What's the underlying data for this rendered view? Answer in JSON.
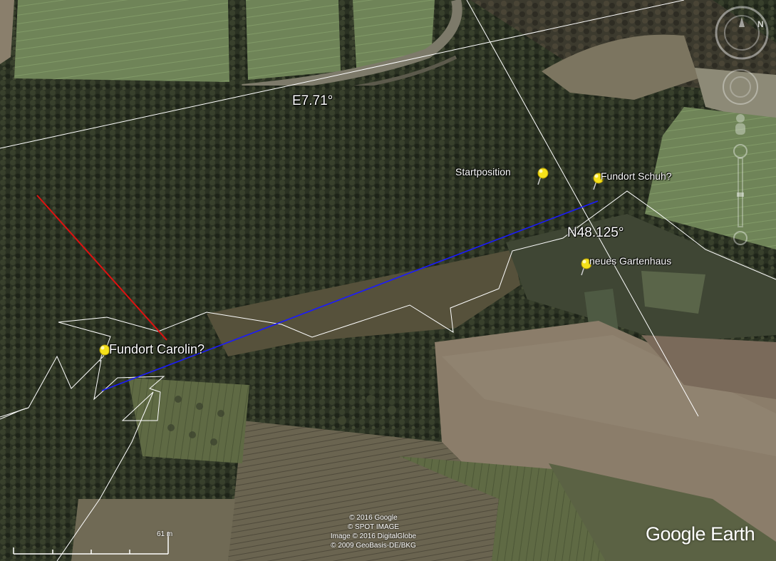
{
  "map": {
    "grid_labels": {
      "longitude": "E7.71°",
      "latitude": "N48.125°"
    },
    "placemarks": [
      {
        "name": "Fundort Carolin?"
      },
      {
        "name": "Startposition"
      },
      {
        "name": "Fundort Schuh?"
      },
      {
        "name": "neues Gartenhaus"
      }
    ],
    "path_colors": {
      "blue_line": "#1a1aff",
      "red_line": "#e01010",
      "outline": "#ffffff"
    },
    "pin_color": "#f5e11a"
  },
  "scale": {
    "label": "61 m"
  },
  "attribution": [
    "© 2016 Google",
    "© SPOT IMAGE",
    "Image © 2016 DigitalGlobe",
    "© 2009 GeoBasis-DE/BKG"
  ],
  "brand": "Google Earth",
  "nav_controls": {
    "compass": "compass-icon",
    "look": "look-joystick-icon",
    "pegman": "street-view-icon",
    "zoom": "zoom-slider-icon"
  }
}
